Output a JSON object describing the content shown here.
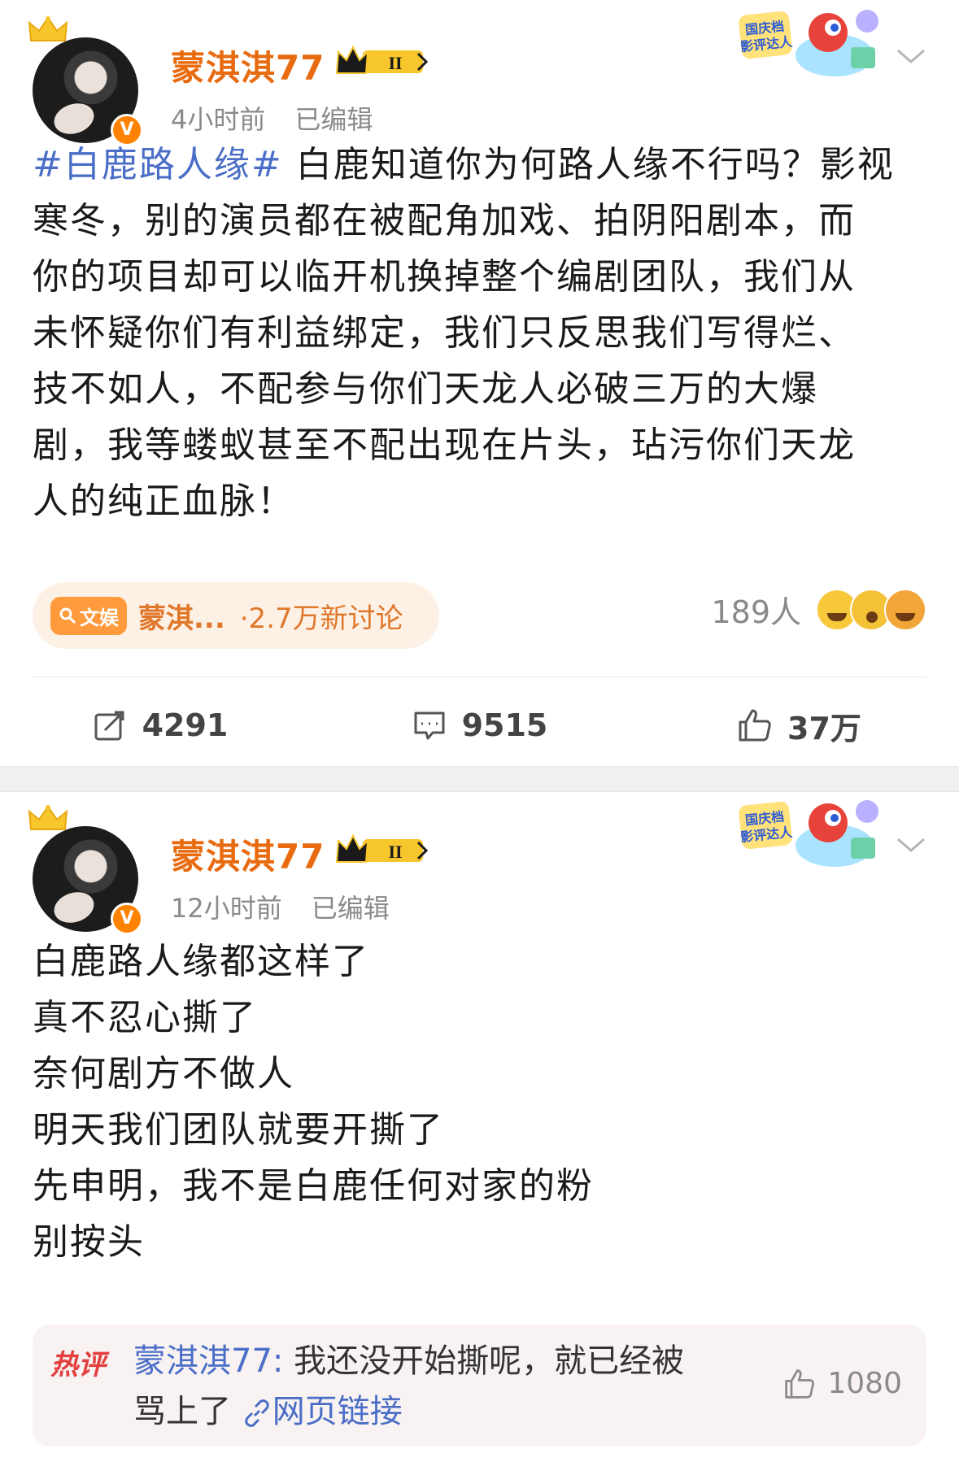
{
  "posts": [
    {
      "username": "蒙淇淇77",
      "vip_level": "II",
      "time": "4小时前",
      "edited": "已编辑",
      "deco_label": "国庆档影评达人",
      "hashtag": "#白鹿路人缘#",
      "lines": [
        " 白鹿知道你为何路人缘不行吗？影视",
        "寒冬，别的演员都在被配角加戏、拍阴阳剧本，而",
        "你的项目却可以临开机换掉整个编剧团队，我们从",
        "未怀疑你们有利益绑定，我们只反思我们写得烂、",
        "技不如人，不配参与你们天龙人必破三万的大爆",
        "剧，我等蝼蚁甚至不配出现在片头，玷污你们天龙",
        "人的纯正血脉！"
      ],
      "topic_tag": "文娱",
      "topic_name": "蒙淇...",
      "topic_count": "·2.7万新讨论",
      "reactions_count": "189人",
      "reposts": "4291",
      "comments": "9515",
      "likes": "37万"
    },
    {
      "username": "蒙淇淇77",
      "vip_level": "II",
      "time": "12小时前",
      "edited": "已编辑",
      "deco_label": "国庆档影评达人",
      "lines": [
        "白鹿路人缘都这样了",
        "真不忍心撕了",
        "奈何剧方不做人",
        "明天我们团队就要开撕了",
        "先申明，我不是白鹿任何对家的粉",
        "别按头"
      ],
      "hot_comment": {
        "label": "热评",
        "user": "蒙淇淇77:",
        "text_line1": " 我还没开始撕呢，就已经被",
        "text_line2": "骂上了",
        "link_text": "网页链接",
        "likes": "1080"
      }
    }
  ],
  "colors": {
    "username": "#e86b10",
    "hashtag_link": "#4a6ec7",
    "meta_gray": "#8a8a8a",
    "hot_label": "#e33f3f"
  },
  "icons": {
    "repost": "repost-icon",
    "comment": "comment-icon",
    "like": "thumbs-up-icon",
    "more": "chevron-down-icon",
    "link": "link-icon",
    "verified": "verified-v-icon",
    "crown": "crown-icon"
  }
}
